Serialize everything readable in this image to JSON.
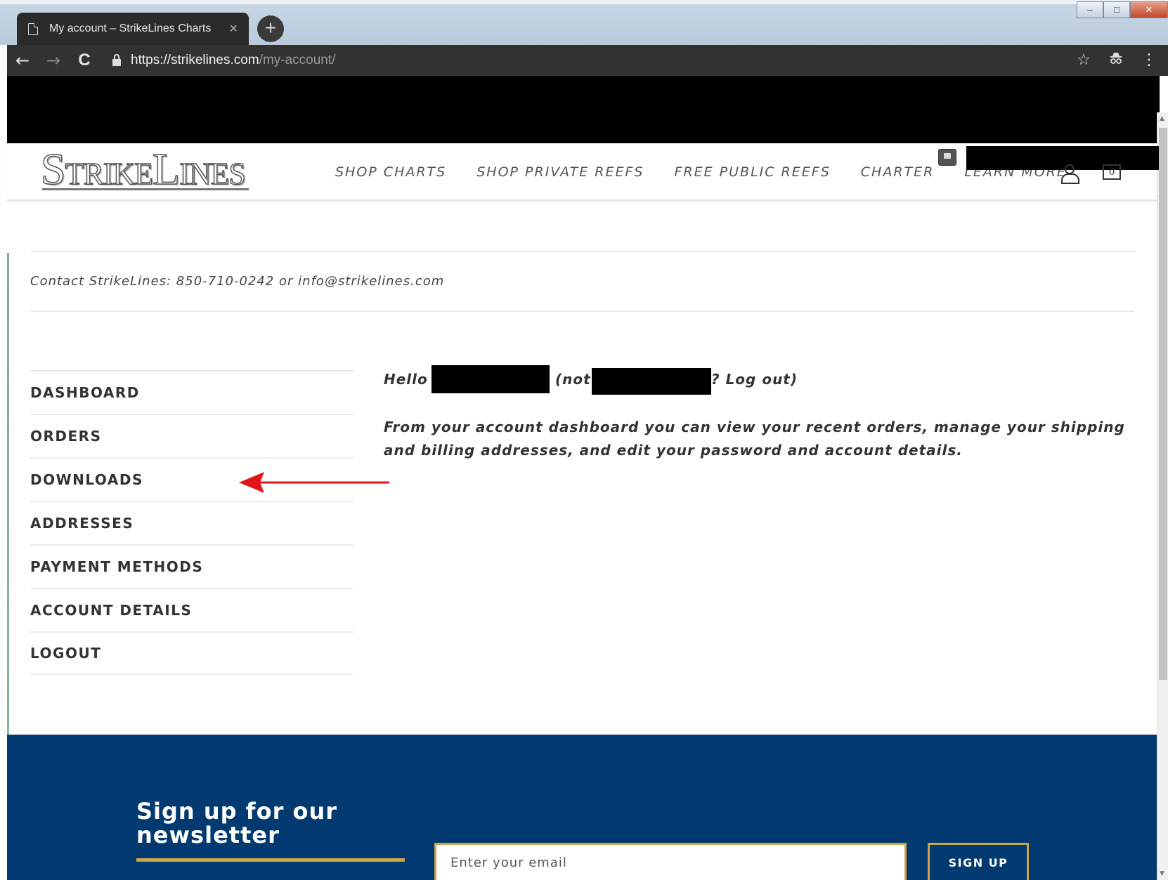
{
  "browser": {
    "tab_title": "My account – StrikeLines Charts",
    "tab_close": "×",
    "new_tab": "+",
    "url_host": "https://strikelines.com",
    "url_path": "/my-account/",
    "back": "←",
    "forward": "→",
    "reload": "C",
    "bookmark": "☆",
    "menu": "⋮"
  },
  "header": {
    "nav": [
      "SHOP CHARTS",
      "SHOP PRIVATE REEFS",
      "FREE PUBLIC REEFS",
      "CHARTER",
      "LEARN MORE"
    ],
    "cart_count": "0"
  },
  "contact_text": "Contact StrikeLines: 850-710-0242 or info@strikelines.com",
  "account_nav": [
    "DASHBOARD",
    "ORDERS",
    "DOWNLOADS",
    "ADDRESSES",
    "PAYMENT METHODS",
    "ACCOUNT DETAILS",
    "LOGOUT"
  ],
  "greeting": {
    "hello": "Hello",
    "not": "(not",
    "logout": "? Log out)"
  },
  "dashboard_text": "From your account dashboard you can view your recent orders, manage your shipping and billing addresses, and edit your password and account details.",
  "footer": {
    "newsletter_line1": "Sign up for our",
    "newsletter_line2": "newsletter",
    "email_placeholder": "Enter your email",
    "signup_label": "SIGN UP"
  },
  "colors": {
    "footer_bg": "#003a70",
    "accent_gold": "#c9a64a",
    "annotation_red": "#e0161b"
  }
}
